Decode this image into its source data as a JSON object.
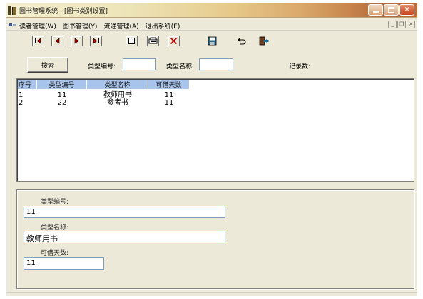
{
  "window": {
    "title": "图书管理系统 - [图书类别设置]",
    "controls": {
      "minimize": "minimize",
      "maximize": "maximize",
      "close": "close"
    }
  },
  "menubar": {
    "items": [
      {
        "label": "读者管理(W)"
      },
      {
        "label": "图书管理(Y)"
      },
      {
        "label": "流通管理(A)"
      },
      {
        "label": "退出系统(E)"
      }
    ],
    "mdi_controls": {
      "minimize": "_",
      "restore": "ð",
      "close": "×"
    }
  },
  "toolbar": {
    "buttons": [
      {
        "name": "first-record-button",
        "icon": "first-icon"
      },
      {
        "name": "prev-record-button",
        "icon": "prev-icon"
      },
      {
        "name": "next-record-button",
        "icon": "next-icon"
      },
      {
        "name": "last-record-button",
        "icon": "last-icon"
      },
      {
        "name": "new-record-button",
        "icon": "new-page-icon"
      },
      {
        "name": "edit-record-button",
        "icon": "edit-icon"
      },
      {
        "name": "delete-record-button",
        "icon": "delete-x-icon"
      },
      {
        "name": "save-record-button",
        "icon": "save-disk-icon"
      },
      {
        "name": "undo-button",
        "icon": "undo-icon"
      },
      {
        "name": "exit-button",
        "icon": "exit-door-icon"
      }
    ]
  },
  "search": {
    "button_label": "搜索",
    "type_id_label": "类型编号:",
    "type_id_value": "",
    "type_name_label": "类型名称:",
    "type_name_value": "",
    "record_count_label": "记录数:"
  },
  "grid": {
    "columns": [
      "序号",
      "类型编号",
      "类型名称",
      "可借天数"
    ],
    "rows": [
      {
        "seq": "1",
        "type_id": "11",
        "type_name": "教师用书",
        "days": "11"
      },
      {
        "seq": "2",
        "type_id": "22",
        "type_name": "参考书",
        "days": "11"
      }
    ]
  },
  "detail": {
    "type_id_label": "类型编号:",
    "type_id_value": "11",
    "type_name_label": "类型名称:",
    "type_name_value": "教师用书",
    "days_label": "可借天数:",
    "days_value": "11"
  },
  "colors": {
    "grid_header_bg": "#a8c4ec",
    "window_bg": "#ece9d8",
    "nav_arrow": "#c00000"
  }
}
